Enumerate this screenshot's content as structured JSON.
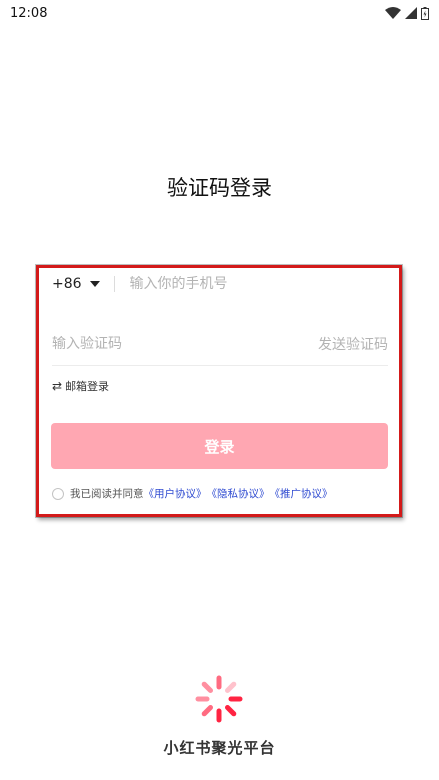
{
  "status_bar": {
    "time": "12:08",
    "wifi_icon": "wifi-icon",
    "signal_icon": "signal-icon",
    "battery_icon": "battery-icon"
  },
  "title": "验证码登录",
  "phone": {
    "country_code": "+86",
    "placeholder": "输入你的手机号",
    "value": ""
  },
  "code": {
    "placeholder": "输入验证码",
    "value": "",
    "send_label": "发送验证码"
  },
  "email_switch": {
    "icon": "swap-icon",
    "label": "邮箱登录"
  },
  "login_button": {
    "label": "登录",
    "color": "#ffa7b2"
  },
  "agreement": {
    "prefix": "我已阅读并同意",
    "links": [
      "《用户协议》",
      "《隐私协议》",
      "《推广协议》"
    ],
    "link_color": "#2f4bd1"
  },
  "footer": {
    "brand_name": "小红书聚光平台",
    "logo_icon": "brand-logo-icon",
    "accent": "#ff2442"
  },
  "highlight": {
    "color": "#d31a1a"
  }
}
